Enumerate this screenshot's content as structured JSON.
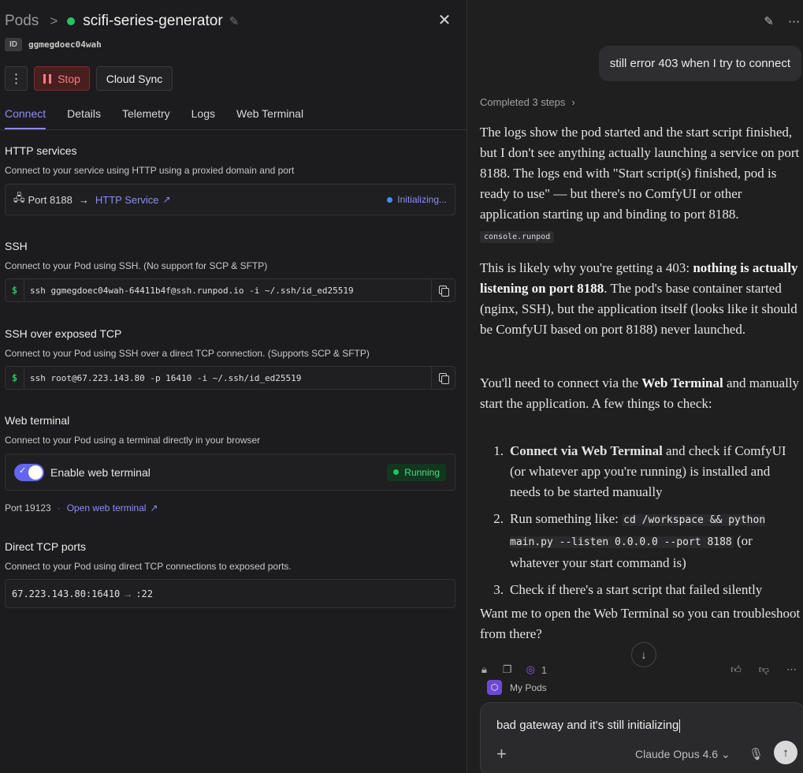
{
  "left": {
    "breadcrumb": {
      "root": "Pods",
      "pod_name": "scifi-series-generator"
    },
    "id_tag": "ID",
    "pod_id": "ggmegdoec04wah",
    "buttons": {
      "stop": "Stop",
      "cloud_sync": "Cloud Sync"
    },
    "tabs": [
      "Connect",
      "Details",
      "Telemetry",
      "Logs",
      "Web Terminal"
    ],
    "http": {
      "title": "HTTP services",
      "desc": "Connect to your service using HTTP using a proxied domain and port",
      "port": "Port 8188",
      "service": "HTTP Service",
      "status": "Initializing..."
    },
    "ssh": {
      "title": "SSH",
      "desc": "Connect to your Pod using SSH. (No support for SCP & SFTP)",
      "prompt": "$",
      "command": "ssh ggmegdoec04wah-64411b4f@ssh.runpod.io -i ~/.ssh/id_ed25519"
    },
    "ssh_tcp": {
      "title": "SSH over exposed TCP",
      "desc": "Connect to your Pod using SSH over a direct TCP connection. (Supports SCP & SFTP)",
      "prompt": "$",
      "command": "ssh root@67.223.143.80 -p 16410 -i ~/.ssh/id_ed25519"
    },
    "web_terminal": {
      "title": "Web terminal",
      "desc": "Connect to your Pod using a terminal directly in your browser",
      "toggle_label": "Enable web terminal",
      "status": "Running",
      "port": "Port 19123",
      "open_link": "Open web terminal"
    },
    "tcp": {
      "title": "Direct TCP ports",
      "desc": "Connect to your Pod using direct TCP connections to exposed ports.",
      "address": "67.223.143.80:16410",
      "target": ":22"
    }
  },
  "right": {
    "user_message": "still error 403 when I try to connect",
    "steps": "Completed 3 steps",
    "p1": "The logs show the pod started and the start script finished, but I don't see anything actually launching a service on port 8188. The logs end with \"Start script(s) finished, pod is ready to use\" — but there's no ComfyUI or other application starting up and binding to port 8188.",
    "p1_tag": "console.runpod",
    "p2_pre": "This is likely why you're getting a 403: ",
    "p2_bold": "nothing is actually listening on port 8188",
    "p2_post": ". The pod's base container started (nginx, SSH), but the application itself (looks like it should be ComfyUI based on port 8188) never launched.",
    "p3_pre": "You'll need to connect via the ",
    "p3_bold": "Web Terminal",
    "p3_post": " and manually start the application. A few things to check:",
    "list": [
      {
        "num": "1.",
        "bold": "Connect via Web Terminal",
        "text": " and check if ComfyUI (or whatever app you're running) is installed and needs to be started manually"
      },
      {
        "num": "2.",
        "pre": "Run something like: ",
        "code": "cd /workspace && python main.py --listen 0.0.0.0 --port 8188",
        "post": " (or whatever your start command is)"
      },
      {
        "num": "3.",
        "text": "Check if there's a start script that failed silently"
      }
    ],
    "p4": "Want me to open the Web Terminal so you can troubleshoot from there?",
    "action_count": "1",
    "source_label": "My Pods",
    "composer_text": "bad gateway and it's still initializing",
    "model": "Claude Opus 4.6"
  }
}
